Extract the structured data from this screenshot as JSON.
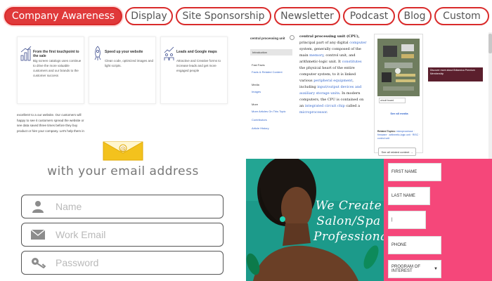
{
  "tabs": [
    {
      "label": "Company Awareness",
      "active": true
    },
    {
      "label": "Display",
      "active": false
    },
    {
      "label": "Site Sponsorship",
      "active": false
    },
    {
      "label": "Newsletter",
      "active": false
    },
    {
      "label": "Podcast",
      "active": false
    },
    {
      "label": "Blog",
      "active": false
    },
    {
      "label": "Custom",
      "active": false
    }
  ],
  "features": {
    "cards": [
      {
        "title": "From the first touchpoint to the sale",
        "body": "Big screen catalogs uses continue to drive the more valuable customers and our brands to the customer success",
        "icon": "bar-growth-icon"
      },
      {
        "title": "Speed up your website",
        "body": "Clean code, optimized images and light scripts.",
        "icon": "rocket-icon"
      },
      {
        "title": "Leads and Google maps",
        "body": "Attractive and Creative forms to increase leads and get more engaged people",
        "icon": "chart-people-icon"
      }
    ],
    "body": "excellent! to a our website. Our customers will happy to see it customers spread the website or see data saved three times before they buy product or hire your company. Let's help them in the user journey."
  },
  "email": {
    "heading": "with your email address",
    "name_placeholder": "Name",
    "work_email_placeholder": "Work Email",
    "password_placeholder": "Password"
  },
  "wiki": {
    "nav_title": "central processing unit",
    "nav_selected": "Introduction",
    "nav_items": [
      {
        "label": "Fast Facts",
        "link": false
      },
      {
        "label": "Facts & Related Content",
        "link": true
      },
      {
        "label": "Media",
        "link": false
      },
      {
        "label": "Images",
        "link": true
      },
      {
        "label": "More",
        "link": false
      },
      {
        "label": "More Articles On This Topic",
        "link": true
      },
      {
        "label": "Contributors",
        "link": true
      },
      {
        "label": "Article History",
        "link": true
      }
    ],
    "article_title": "central processing unit (CPU),",
    "article_p1": "principal part of any digital",
    "link_computer": "computer",
    "article_p2": "system, generally composed of the main",
    "link_memory": "memory",
    "article_p3": ", control unit, and arithmetic-logic unit. It",
    "link_constitutes": "constitutes",
    "article_p4": "the physical heart of the entire computer system; to it is linked various",
    "link_peripheral": "peripheral equipment",
    "article_p5": ", including",
    "link_io": "input/output devices and auxiliary storage units",
    "article_p6": ". In modern computers, the CPU is contained on an",
    "link_chip": "integrated circuit chip",
    "article_p7": "called a",
    "link_micro": "microprocessor",
    "image_caption": "circuit board",
    "see_all_media": "See all media",
    "related_label": "Related Topics:",
    "related_links": "microprocessor · firmware · arithmetic-logic unit · RISC · control unit",
    "related_button": "See all related content →",
    "ad_text": "Discover more about Britannica Premium Membership"
  },
  "salon": {
    "heading_line1": "We Create",
    "heading_line2": "Salon/Spa",
    "heading_line3": "Professionals",
    "first_name": "FIRST NAME",
    "last_name": "LAST NAME",
    "phone": "PHONE",
    "program": "PROGRAM OF INTEREST"
  },
  "colors": {
    "tab_border": "#d92b2b",
    "tab_active": "#e0393a",
    "salon_teal": "#1e9c8c",
    "salon_pink": "#f5477a"
  }
}
